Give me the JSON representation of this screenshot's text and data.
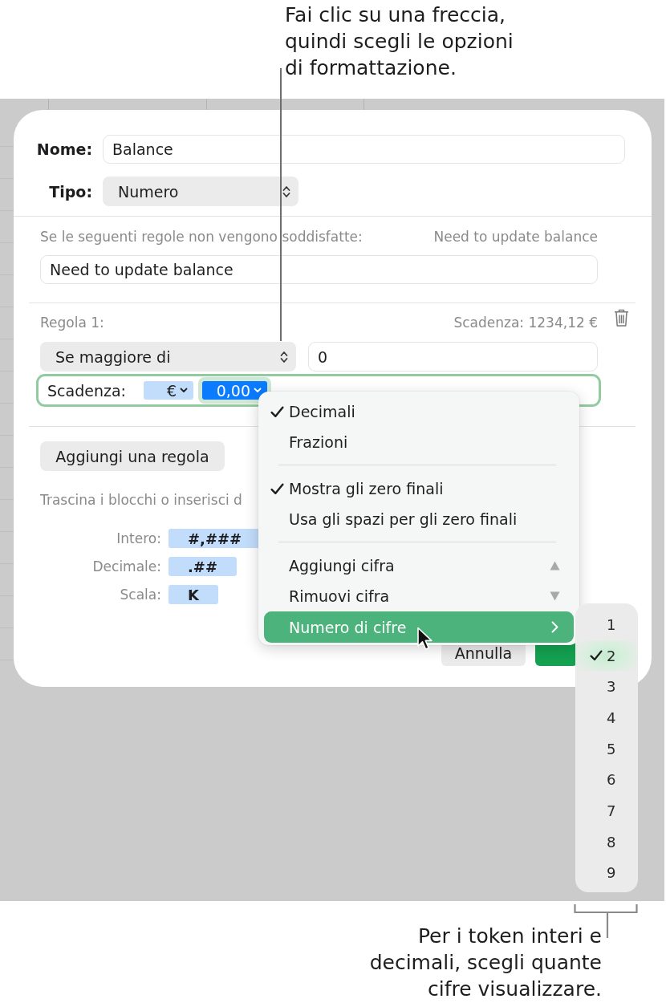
{
  "callouts": [
    {
      "kind": "top",
      "text": "Fai clic su una freccia, quindi scegli le opzioni di formattazione."
    },
    {
      "kind": "bottom",
      "text": "Per i token interi e decimali, scegli quante cifre visualizzare."
    }
  ],
  "dialog": {
    "name_field": {
      "label": "Nome:",
      "value": "Balance"
    },
    "type_popup": {
      "label": "Tipo:",
      "value": "Numero"
    },
    "rule_message": {
      "caption": "Se le seguenti regole non vengono soddisfatte:",
      "preview": "Need to update balance",
      "value": "Need to update balance"
    },
    "rule": {
      "title": "Regola 1:",
      "preview": "Scadenza: 1234,12 €",
      "condition": "Se maggiore di",
      "value": "0",
      "format_field": {
        "focused": true,
        "label": "Scadenza:",
        "tokens": [
          {
            "label": "€",
            "selected": false
          },
          {
            "label": "0,00",
            "selected": true
          }
        ]
      }
    },
    "add_rule_button": "Aggiungi una regola",
    "hint": "Trascina i blocchi o inserisci d",
    "format_tokens": [
      {
        "label": "Intero:",
        "token": "#,###"
      },
      {
        "label": "Decimale:",
        "token": ".##"
      },
      {
        "label": "Scala:",
        "token": "K"
      }
    ],
    "buttons": [
      {
        "kind": "secondary",
        "label": "Annulla"
      },
      {
        "kind": "primary"
      }
    ]
  },
  "format_menu": {
    "groups": [
      {
        "items": [
          {
            "kind": "plain",
            "label": "Decimali",
            "checked": true,
            "highlighted": false
          },
          {
            "kind": "plain",
            "label": "Frazioni",
            "checked": false,
            "highlighted": false
          }
        ]
      },
      {
        "items": [
          {
            "kind": "plain",
            "label": "Mostra gli zero finali",
            "checked": true,
            "highlighted": false
          },
          {
            "kind": "plain",
            "label": "Usa gli spazi per gli zero finali",
            "checked": false,
            "highlighted": false
          }
        ]
      },
      {
        "items": [
          {
            "kind": "increment",
            "label": "Aggiungi cifra",
            "checked": false,
            "highlighted": false
          },
          {
            "kind": "decrement",
            "label": "Rimuovi cifra",
            "checked": false,
            "highlighted": false
          },
          {
            "kind": "submenu",
            "label": "Numero di cifre",
            "checked": false,
            "highlighted": true
          }
        ]
      }
    ]
  },
  "digits_submenu": {
    "items": [
      {
        "label": "1",
        "selected": false
      },
      {
        "label": "2",
        "selected": true
      },
      {
        "label": "3",
        "selected": false
      },
      {
        "label": "4",
        "selected": false
      },
      {
        "label": "5",
        "selected": false
      },
      {
        "label": "6",
        "selected": false
      },
      {
        "label": "7",
        "selected": false
      },
      {
        "label": "8",
        "selected": false
      },
      {
        "label": "9",
        "selected": false
      }
    ]
  }
}
